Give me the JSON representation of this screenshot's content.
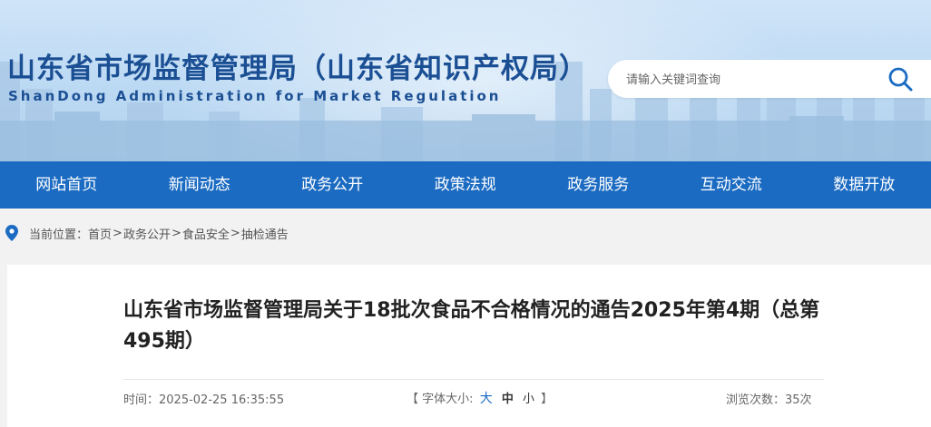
{
  "header": {
    "title": "山东省市场监督管理局（山东省知识产权局）",
    "subtitle": "ShanDong Administration for Market Regulation",
    "search_placeholder": "请输入关键词查询",
    "search_icon": "search-icon"
  },
  "nav": {
    "items": [
      {
        "label": "网站首页"
      },
      {
        "label": "新闻动态"
      },
      {
        "label": "政务公开"
      },
      {
        "label": "政策法规"
      },
      {
        "label": "政务服务"
      },
      {
        "label": "互动交流"
      },
      {
        "label": "数据开放"
      }
    ]
  },
  "breadcrumb": {
    "prefix": "当前位置：",
    "items": [
      "首页",
      "政务公开",
      "食品安全",
      "抽检通告"
    ],
    "separator": ">"
  },
  "article": {
    "title": "山东省市场监督管理局关于18批次食品不合格情况的通告2025年第4期（总第495期）",
    "time_label": "时间：",
    "time_value": "2025-02-25 16:35:55",
    "font_open": "【",
    "font_label": "字体大小:",
    "font_large": "大",
    "font_medium": "中",
    "font_small": "小",
    "font_close": "】",
    "views_label": "浏览次数：",
    "views_value": "35次"
  },
  "colors": {
    "brand_blue": "#1b4f94",
    "nav_blue": "#1b6bc2",
    "accent": "#1b6bc2"
  }
}
